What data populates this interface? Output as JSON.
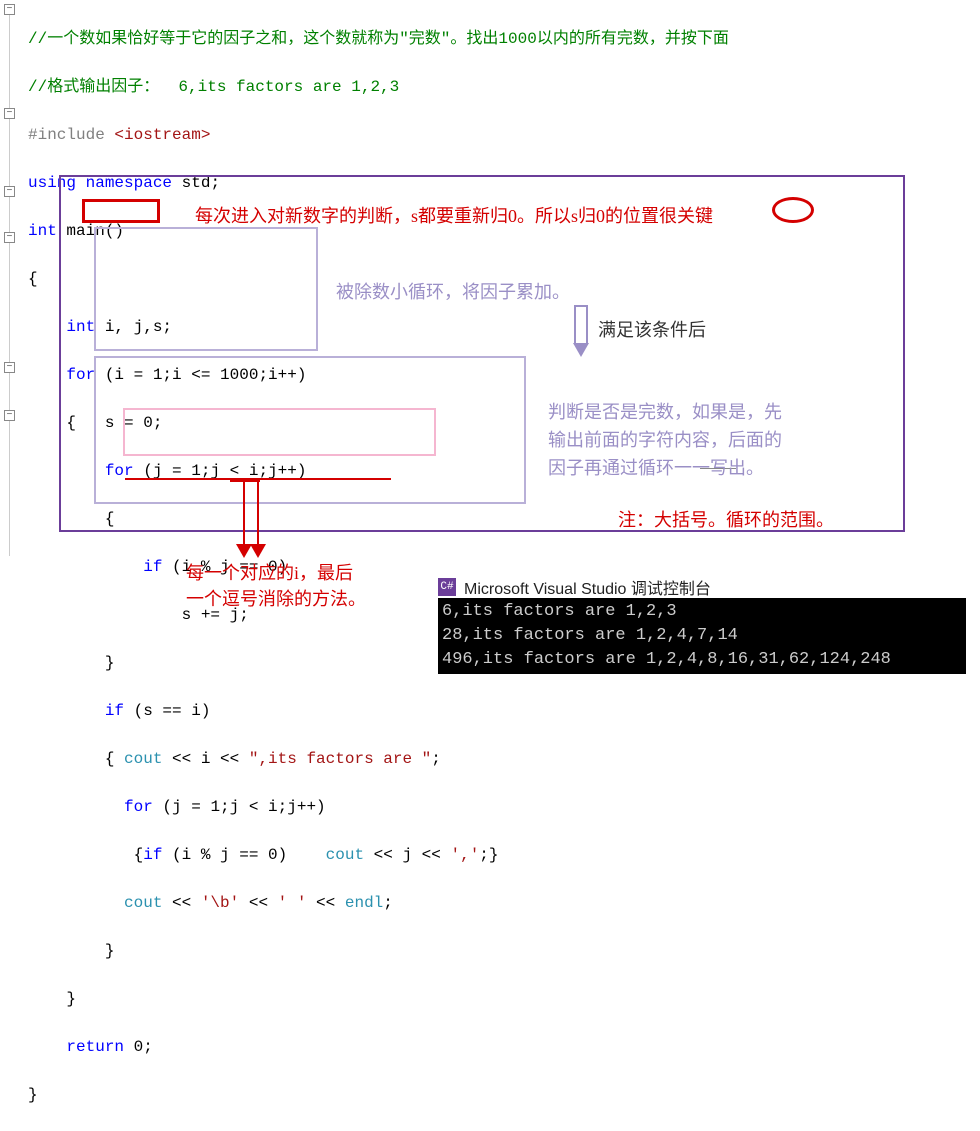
{
  "comment1": "//一个数如果恰好等于它的因子之和，这个数就称为\"完数\"。找出1000以内的所有完数，并按下面",
  "comment2": "//格式输出因子：  6,its factors are 1,2,3",
  "include_pp": "#include ",
  "include_hdr": "<iostream>",
  "using_kw": "using ",
  "namespace_kw": "namespace ",
  "std_name": "std",
  "int_kw": "int",
  "main_name": " main()",
  "decl": "    int i, j,s;",
  "for_outer": "    for (i = 1;i <= 1000;i++)",
  "brace_s0": "    {   s = 0;",
  "for_inner": "        for (j = 1;j < i;j++)",
  "open_b1": "        {",
  "if_mod": "            if (i % j == 0)",
  "s_plus": "                s += j;",
  "close_b1": "        }",
  "if_si": "        if (s == i)",
  "cout1_a": "        { cout << i << ",
  "cout1_str": "\",its factors are \"",
  "cout1_b": ";",
  "for_inner2": "          for (j = 1;j < i;j++)",
  "inner_if_a": "           {if (i % j == 0)    cout << j << ",
  "inner_if_str": "','",
  "inner_if_b": ";}",
  "cout2_a": "          cout << ",
  "cout2_s1": "'\\b'",
  "cout2_m": " << ",
  "cout2_s2": "' '",
  "cout2_e": " << endl;",
  "close_b2": "        }",
  "close_b3": "    }",
  "return": "    return 0;",
  "close_main": "}",
  "annot_red1": "每次进入对新数字的判断，s都要重新归0。所以s归0的位置很关键",
  "annot_purple1": "被除数小循环，将因子累加。",
  "annot_dark1": "满足该条件后",
  "annot_purple2a": "判断是否是完数，如果是，先",
  "annot_purple2b": "输出前面的字符内容，后面的",
  "annot_purple2c": "因子再通过循环一一写出。",
  "annot_red2": "注：大括号。循环的范围。",
  "annot_red3a": "每一个对应的i，最后",
  "annot_red3b": "一个逗号消除的方法。",
  "console_title": "Microsoft Visual Studio 调试控制台",
  "console_lines": "6,its factors are 1,2,3\n28,its factors are 1,2,4,7,14\n496,its factors are 1,2,4,8,16,31,62,124,248",
  "gutter_minus": "−",
  "icon_cs": "C#"
}
